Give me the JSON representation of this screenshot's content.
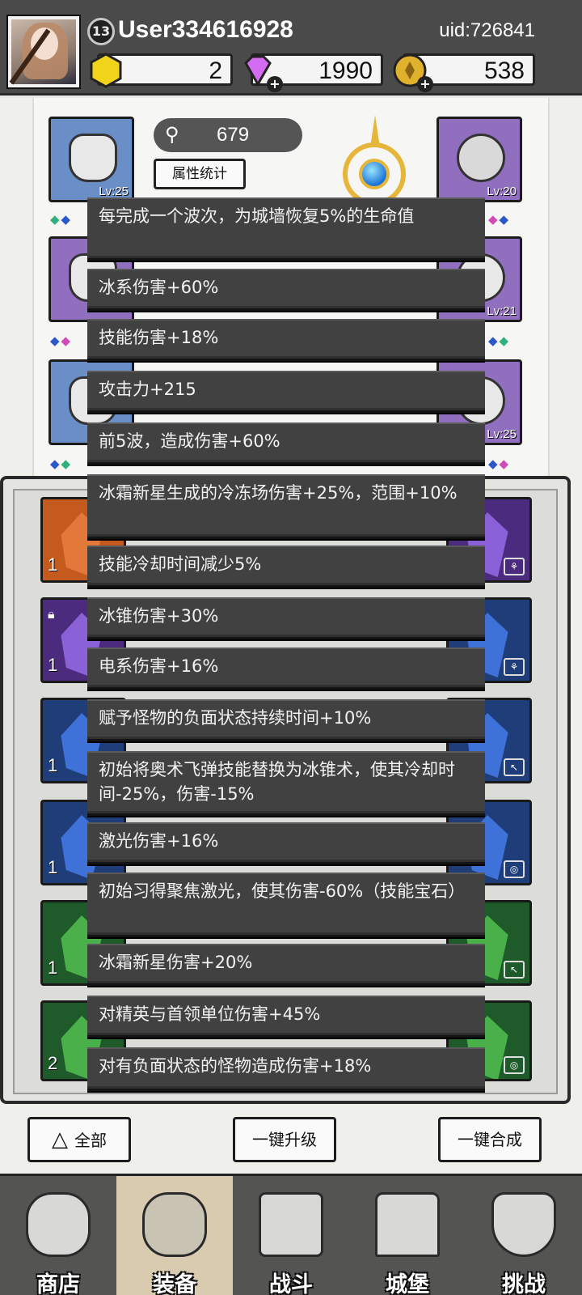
{
  "header": {
    "username": "User334616928",
    "uid": "uid:726841",
    "level": "13",
    "currencies": {
      "gold_gem": "2",
      "diamond": "1990",
      "coin": "538"
    }
  },
  "equipment": {
    "power": "679",
    "stat_button": "属性统计",
    "slots": [
      {
        "level": "Lv:25"
      },
      {
        "level": "Lv:20"
      },
      {
        "level": "Lv:21"
      },
      {
        "level": "Lv:25"
      }
    ]
  },
  "gems": {
    "counts": [
      "1",
      "1",
      "1",
      "1",
      "1",
      "2"
    ]
  },
  "tooltip": {
    "lines": [
      "每完成一个波次，为城墙恢复5%的生命值",
      "冰系伤害+60%",
      "技能伤害+18%",
      "攻击力+215",
      "前5波，造成伤害+60%",
      "冰霜新星生成的冷冻场伤害+25%，范围+10%",
      "技能冷却时间减少5%",
      "冰锥伤害+30%",
      "电系伤害+16%",
      "赋予怪物的负面状态持续时间+10%",
      "初始将奥术飞弹技能替换为冰锥术，使其冷却时间-25%，伤害-15%",
      "激光伤害+16%",
      "初始习得聚焦激光，使其伤害-60%（技能宝石）",
      "冰霜新星伤害+20%",
      "对精英与首领单位伤害+45%",
      "对有负面状态的怪物造成伤害+18%"
    ]
  },
  "actions": {
    "filter_all": "全部",
    "one_click_upgrade": "一键升级",
    "one_click_merge": "一键合成"
  },
  "nav": {
    "shop": "商店",
    "equipment": "装备",
    "battle": "战斗",
    "castle": "城堡",
    "challenge": "挑战"
  },
  "colors": {
    "tooltip_bg": "#414141",
    "topbar_bg": "#4a4a4a",
    "nav_active": "#d9cbb0"
  }
}
